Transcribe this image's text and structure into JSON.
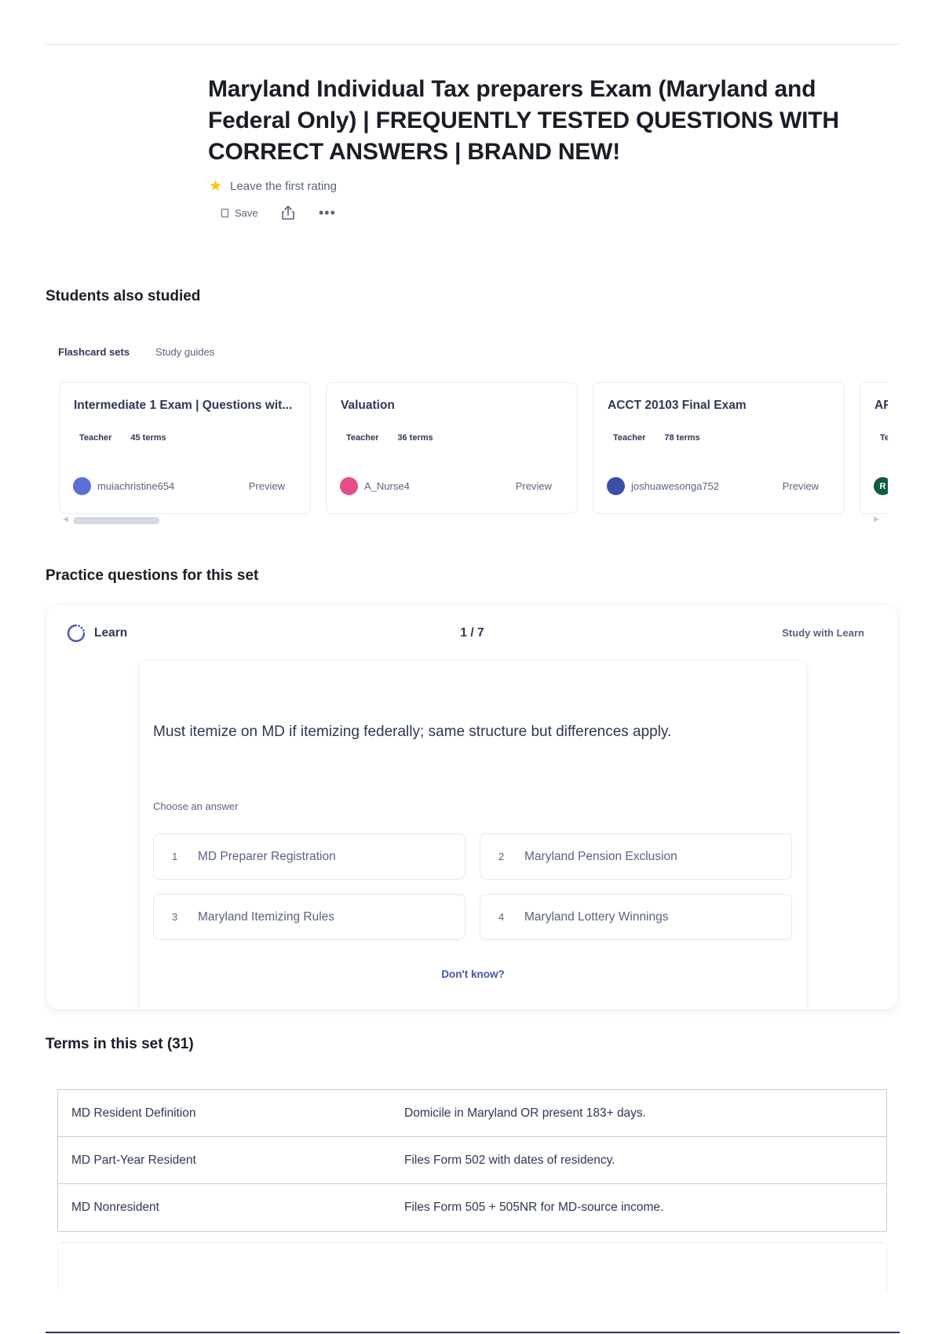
{
  "page": {
    "title": "Maryland Individual Tax preparers Exam (Maryland and Federal Only) | FREQUENTLY TESTED QUESTIONS WITH CORRECT ANSWERS | BRAND NEW!",
    "rating_text": "Leave the first rating",
    "actions": {
      "save_label": "Save",
      "share_icon": "share-icon",
      "more_icon": "more-icon"
    }
  },
  "students_also_studied": {
    "heading": "Students also studied",
    "tabs": [
      {
        "label": "Flashcard sets",
        "active": true
      },
      {
        "label": "Study guides",
        "active": false
      }
    ],
    "cards": [
      {
        "title": "Intermediate 1 Exam | Questions wit...",
        "role": "Teacher",
        "terms": "45 terms",
        "user": "muiachristine654",
        "preview": "Preview",
        "avatar_color": "#5b6fd6"
      },
      {
        "title": "Valuation",
        "role": "Teacher",
        "terms": "36 terms",
        "user": "A_Nurse4",
        "preview": "Preview",
        "avatar_color": "#e94c8b"
      },
      {
        "title": "ACCT 20103 Final Exam",
        "role": "Teacher",
        "terms": "78 terms",
        "user": "joshuawesonga752",
        "preview": "Preview",
        "avatar_color": "#3b4fa8"
      },
      {
        "title": "AR",
        "role": "Te",
        "terms": "",
        "user": "",
        "preview": "",
        "avatar_color": "#0f5c43",
        "avatar_letter": "R"
      }
    ]
  },
  "practice": {
    "heading": "Practice questions for this set",
    "mode_label": "Learn",
    "counter": "1 / 7",
    "study_link": "Study with Learn",
    "question": "Must itemize on MD if itemizing federally; same structure but differences apply.",
    "prompt": "Choose an answer",
    "options": [
      {
        "num": "1",
        "text": "MD Preparer Registration"
      },
      {
        "num": "2",
        "text": "Maryland Pension Exclusion"
      },
      {
        "num": "3",
        "text": "Maryland Itemizing Rules"
      },
      {
        "num": "4",
        "text": "Maryland Lottery Winnings"
      }
    ],
    "dont_know": "Don't know?"
  },
  "terms": {
    "heading": "Terms in this set (31)",
    "rows": [
      {
        "term": "MD Resident Definition",
        "definition": "Domicile in Maryland OR present 183+ days."
      },
      {
        "term": "MD Part-Year Resident",
        "definition": "Files Form 502 with dates of residency."
      },
      {
        "term": "MD Nonresident",
        "definition": "Files Form 505 + 505NR for MD-source income."
      }
    ]
  },
  "colors": {
    "text_primary": "#2e3856",
    "text_secondary": "#586380",
    "accent": "#4257b2",
    "star": "#ffc20e"
  }
}
